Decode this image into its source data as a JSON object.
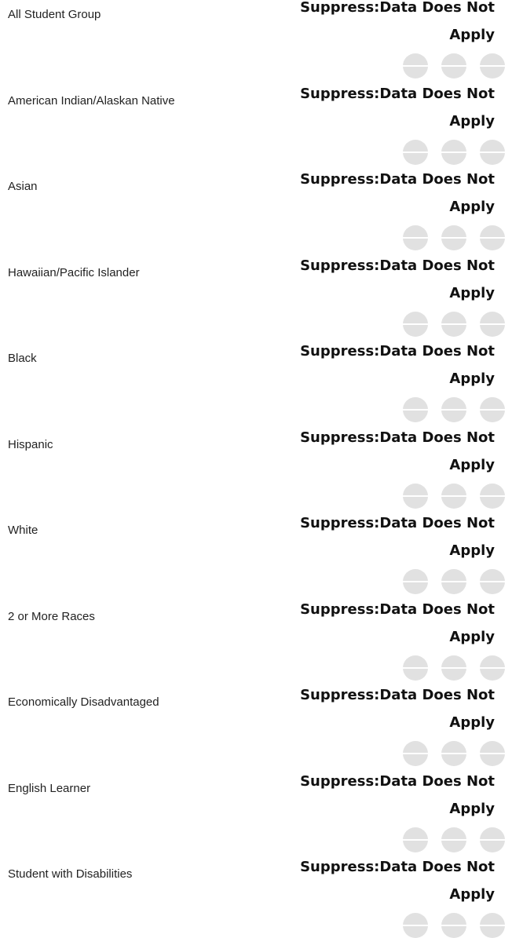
{
  "status_text": "Suppress:Data Does Not Apply",
  "indicator_icon": "minus-circle-icon",
  "indicator_color": "#e1e1e1",
  "rows": [
    {
      "group": "All Student Group",
      "status": "Suppress:Data Does Not Apply"
    },
    {
      "group": "American Indian/Alaskan Native",
      "status": "Suppress:Data Does Not Apply"
    },
    {
      "group": "Asian",
      "status": "Suppress:Data Does Not Apply"
    },
    {
      "group": "Hawaiian/Pacific Islander",
      "status": "Suppress:Data Does Not Apply"
    },
    {
      "group": "Black",
      "status": "Suppress:Data Does Not Apply"
    },
    {
      "group": "Hispanic",
      "status": "Suppress:Data Does Not Apply"
    },
    {
      "group": "White",
      "status": "Suppress:Data Does Not Apply"
    },
    {
      "group": "2 or More Races",
      "status": "Suppress:Data Does Not Apply"
    },
    {
      "group": "Economically Disadvantaged",
      "status": "Suppress:Data Does Not Apply"
    },
    {
      "group": "English Learner",
      "status": "Suppress:Data Does Not Apply"
    },
    {
      "group": "Student with Disabilities",
      "status": "Suppress:Data Does Not Apply"
    }
  ]
}
